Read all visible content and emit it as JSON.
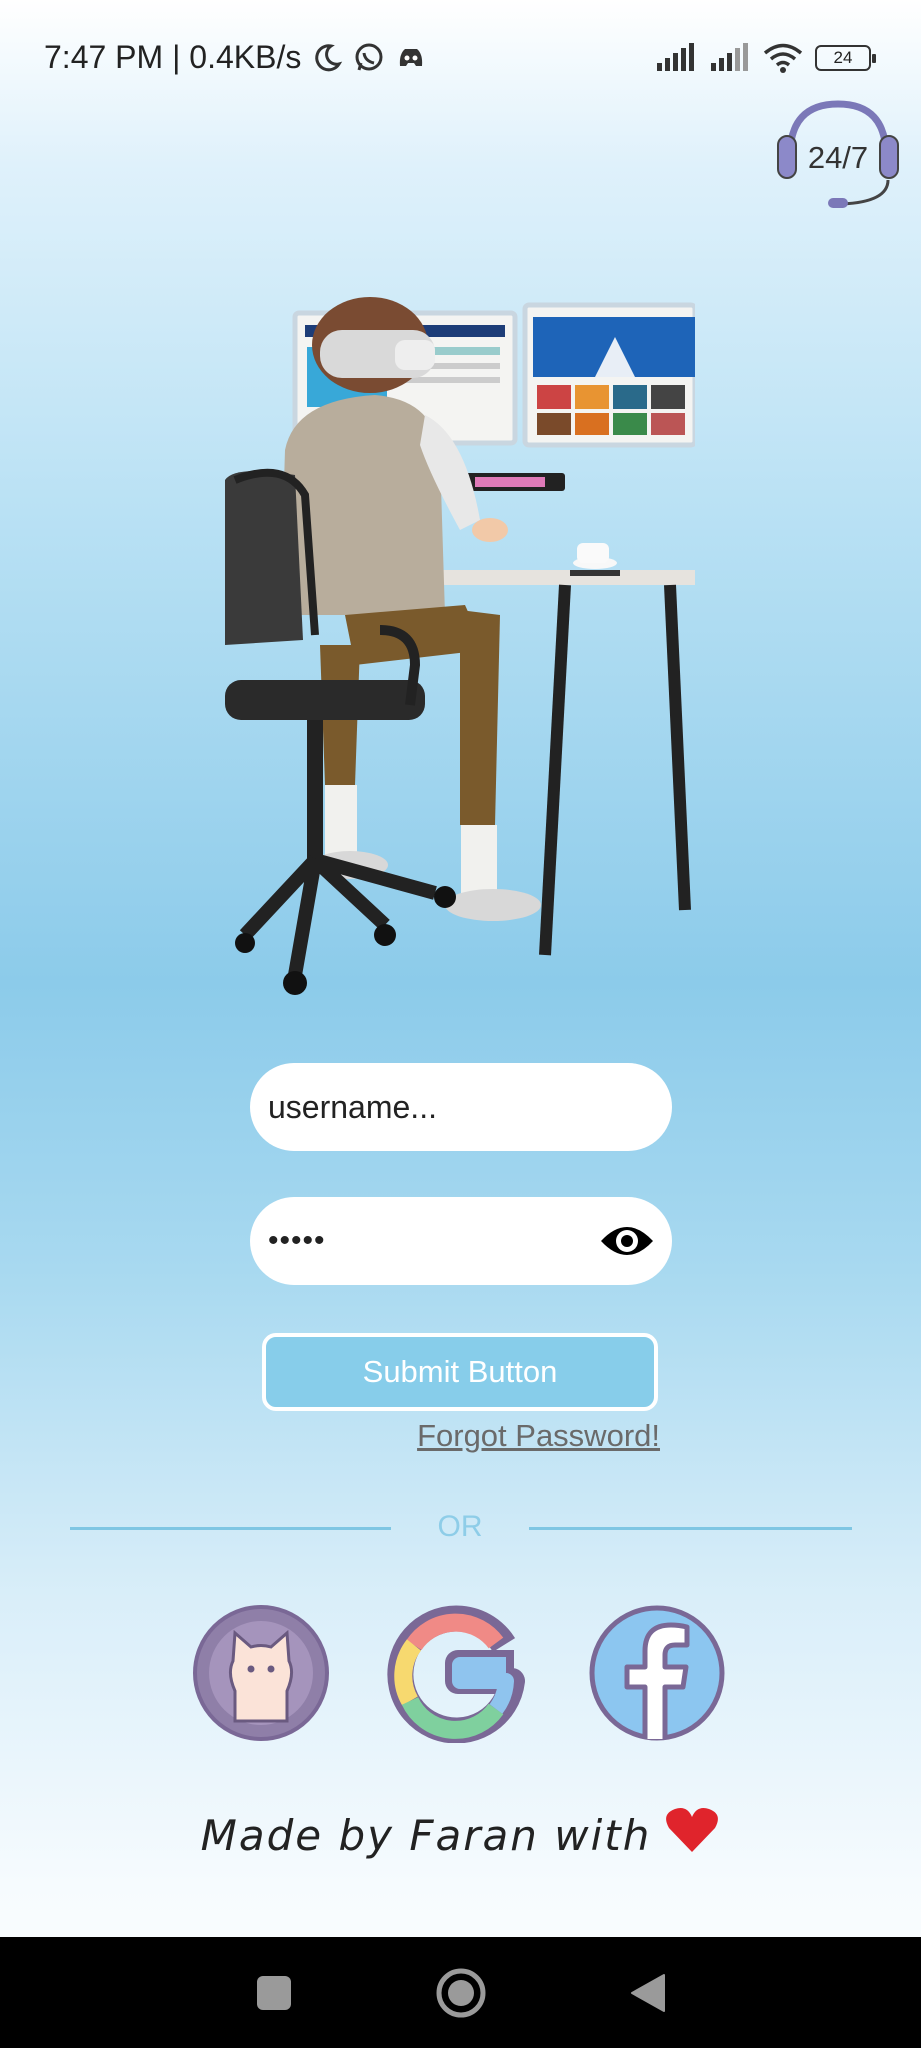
{
  "status_bar": {
    "time_speed": "7:47 PM | 0.4KB/s",
    "battery_level": "24",
    "icons": [
      "moon-icon",
      "whatsapp-icon",
      "discord-icon",
      "signal-icon",
      "signal-icon",
      "wifi-icon",
      "battery-icon"
    ]
  },
  "support_badge": {
    "label": "24/7",
    "icon": "headset-icon"
  },
  "hero": {
    "icon": "person-at-desk-illustration"
  },
  "login": {
    "username_placeholder": "username...",
    "password_value": "•••••",
    "toggle_visibility_icon": "eye-icon",
    "submit_label": "Submit Button",
    "forgot_label": "Forgot Password!"
  },
  "divider": {
    "label": "OR"
  },
  "social": [
    {
      "name": "github",
      "icon": "github-icon"
    },
    {
      "name": "google",
      "icon": "google-icon"
    },
    {
      "name": "facebook",
      "icon": "facebook-icon"
    }
  ],
  "footer": {
    "text": "Made by Faran with",
    "icon": "heart-icon"
  },
  "nav": {
    "icons": [
      "recent-apps-icon",
      "home-icon",
      "back-icon"
    ]
  },
  "colors": {
    "accent": "#87cdea",
    "divider": "#7fc6e3",
    "heart": "#e0242c",
    "nav_bar": "#000000"
  }
}
